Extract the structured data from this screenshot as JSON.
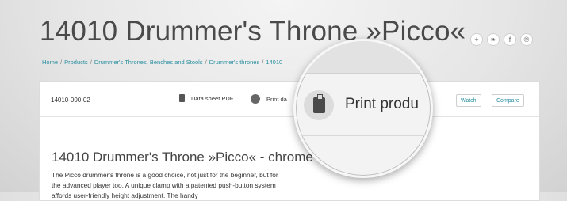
{
  "page": {
    "title": "14010 Drummer's Throne »Picco«"
  },
  "social": [
    {
      "icon": "plus-icon",
      "glyph": "+"
    },
    {
      "icon": "twitter-icon",
      "glyph": "❧"
    },
    {
      "icon": "facebook-icon",
      "glyph": "f"
    },
    {
      "icon": "pinterest-icon",
      "glyph": "℗"
    }
  ],
  "breadcrumb": {
    "items": [
      "Home",
      "Products",
      "Drummer's Thrones, Benches and Stools",
      "Drummer's thrones",
      "14010"
    ],
    "separator": "/"
  },
  "toolbar": {
    "sku": "14010-000-02",
    "datasheet_label": "Data sheet PDF",
    "print_label": "Print da",
    "watch_label": "Watch",
    "compare_label": "Compare"
  },
  "product": {
    "heading": "14010 Drummer's Throne »Picco« - chrome",
    "description": "The Picco drummer's throne is a good choice, not just for the beginner, but for the advanced player too. A unique clamp with a patented push-button system affords user-friendly height adjustment. The handy"
  },
  "magnifier": {
    "text": "Print produ"
  },
  "colors": {
    "accent": "#2a8fa0",
    "title": "#4a4a4a"
  }
}
